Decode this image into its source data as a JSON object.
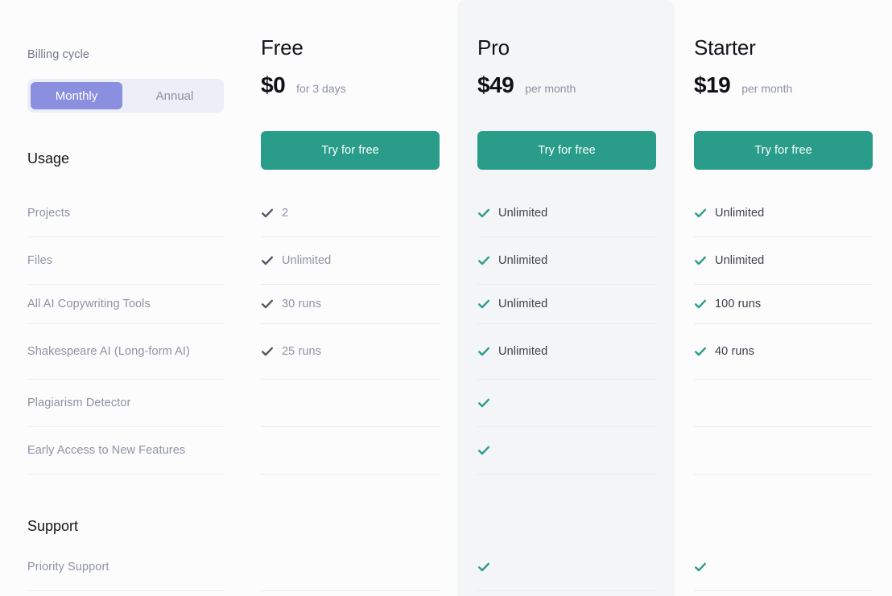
{
  "billing": {
    "label": "Billing cycle",
    "options": [
      {
        "label": "Monthly",
        "active": true
      },
      {
        "label": "Annual",
        "active": false
      }
    ],
    "active_color": "#8a8fe0",
    "track_color": "#eceef8"
  },
  "sections": [
    {
      "heading": "Usage",
      "features": [
        "Projects",
        "Files",
        "All AI Copywriting Tools",
        "Shakespeare AI (Long-form AI)",
        "Plagiarism Detector",
        "Early Access to New Features"
      ]
    },
    {
      "heading": "Support",
      "features": [
        "Priority Support"
      ]
    }
  ],
  "plans": [
    {
      "name": "Free",
      "price": "$0",
      "period": "for 3 days",
      "cta": "Try for free",
      "check_color": "#55585f",
      "highlight": false,
      "values": [
        {
          "check": true,
          "text": "2"
        },
        {
          "check": true,
          "text": "Unlimited"
        },
        {
          "check": true,
          "text": "30 runs"
        },
        {
          "check": true,
          "text": "25 runs"
        },
        {
          "check": false,
          "text": ""
        },
        {
          "check": false,
          "text": ""
        },
        {
          "check": false,
          "text": ""
        }
      ]
    },
    {
      "name": "Pro",
      "price": "$49",
      "period": "per month",
      "cta": "Try for free",
      "check_color": "#2a9d8a",
      "highlight": true,
      "values": [
        {
          "check": true,
          "text": "Unlimited"
        },
        {
          "check": true,
          "text": "Unlimited"
        },
        {
          "check": true,
          "text": "Unlimited"
        },
        {
          "check": true,
          "text": "Unlimited"
        },
        {
          "check": true,
          "text": ""
        },
        {
          "check": true,
          "text": ""
        },
        {
          "check": true,
          "text": ""
        }
      ]
    },
    {
      "name": "Starter",
      "price": "$19",
      "period": "per month",
      "cta": "Try for free",
      "check_color": "#2a9d8a",
      "highlight": false,
      "values": [
        {
          "check": true,
          "text": "Unlimited"
        },
        {
          "check": true,
          "text": "Unlimited"
        },
        {
          "check": true,
          "text": "100 runs"
        },
        {
          "check": true,
          "text": "40 runs"
        },
        {
          "check": false,
          "text": ""
        },
        {
          "check": false,
          "text": ""
        },
        {
          "check": true,
          "text": ""
        }
      ]
    }
  ],
  "colors": {
    "accent_teal": "#2a9d8a",
    "accent_purple": "#8a8fe0",
    "page_bg": "#fcfcfd",
    "panel_bg": "#f4f5f6",
    "divider": "#edeef5"
  },
  "row_geometry": {
    "tops": [
      236,
      295,
      354,
      403,
      472,
      531,
      676
    ],
    "heights": [
      59,
      59,
      49,
      69,
      59,
      59,
      59
    ]
  }
}
